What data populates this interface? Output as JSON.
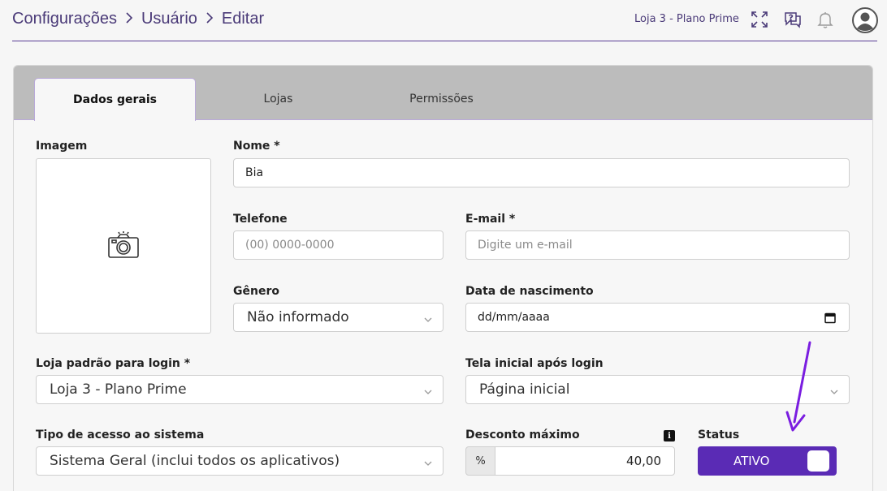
{
  "header": {
    "breadcrumb": [
      "Configurações",
      "Usuário",
      "Editar"
    ],
    "store": "Loja 3 - Plano Prime",
    "icons": [
      "expand-icon",
      "help-chat-icon",
      "bell-icon",
      "user-avatar-icon"
    ]
  },
  "tabs": [
    {
      "label": "Dados gerais",
      "active": true
    },
    {
      "label": "Lojas",
      "active": false
    },
    {
      "label": "Permissões",
      "active": false
    }
  ],
  "form": {
    "image": {
      "label": "Imagem",
      "icon": "camera-icon"
    },
    "nome": {
      "label": "Nome *",
      "value": "Bia"
    },
    "telefone": {
      "label": "Telefone",
      "placeholder": "(00) 0000-0000"
    },
    "email": {
      "label": "E-mail *",
      "placeholder": "Digite um e-mail"
    },
    "genero": {
      "label": "Gênero",
      "value": "Não informado"
    },
    "nascimento": {
      "label": "Data de nascimento",
      "value": "dd/mm/aaaa"
    },
    "loja_padrao": {
      "label": "Loja padrão para login *",
      "value": "Loja 3 - Plano Prime"
    },
    "tela_inicial": {
      "label": "Tela inicial após login",
      "value": "Página inicial"
    },
    "tipo_acesso": {
      "label": "Tipo de acesso ao sistema",
      "value": "Sistema Geral (inclui todos os aplicativos)"
    },
    "desconto": {
      "label": "Desconto máximo",
      "unit": "%",
      "value": "40,00",
      "info_icon": "info-icon"
    },
    "status": {
      "label": "Status",
      "value": "ATIVO",
      "on": true
    }
  },
  "colors": {
    "accent": "#5a2bb5",
    "header_text": "#4a3a78",
    "annotation_arrow": "#7a1de0"
  }
}
